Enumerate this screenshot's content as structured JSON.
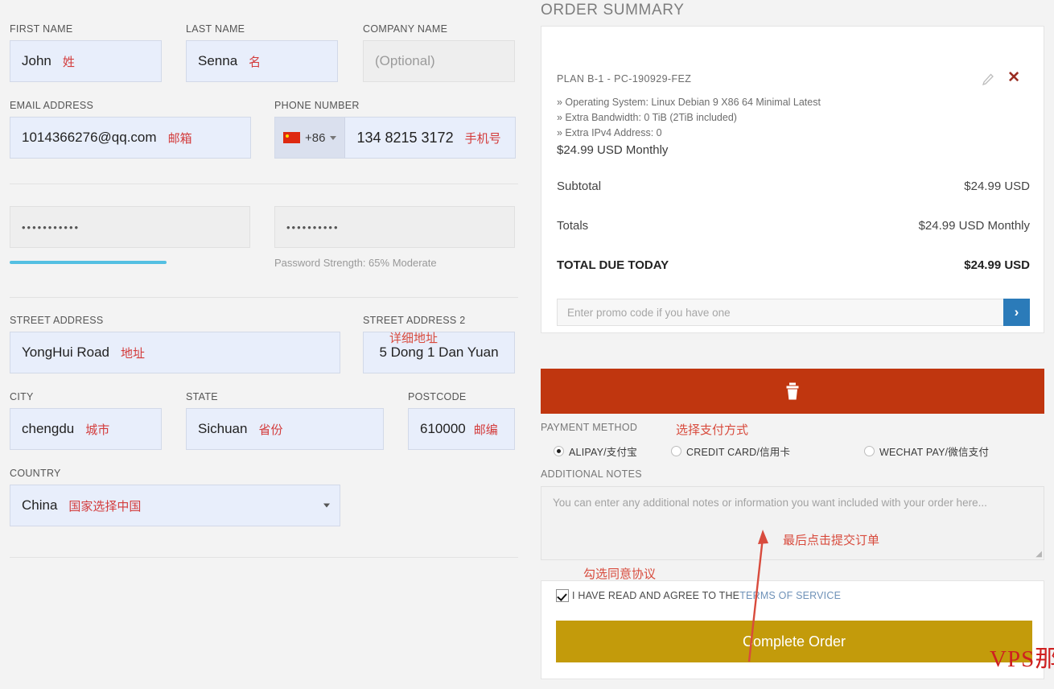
{
  "form": {
    "first_name": {
      "label": "FIRST NAME",
      "value": "John",
      "annotation": "姓"
    },
    "last_name": {
      "label": "LAST NAME",
      "value": "Senna",
      "annotation": "名"
    },
    "company_name": {
      "label": "COMPANY NAME",
      "placeholder": "(Optional)",
      "value": ""
    },
    "email": {
      "label": "EMAIL ADDRESS",
      "value": "1014366276@qq.com",
      "annotation": "邮箱"
    },
    "phone": {
      "label": "PHONE NUMBER",
      "dial_code": "+86",
      "value": "134 8215 3172",
      "annotation": "手机号",
      "flag": "china-flag-icon"
    },
    "password": {
      "value": "•••••••••••"
    },
    "password_confirm": {
      "value": "••••••••••"
    },
    "password_strength": {
      "text": "Password Strength: 65% Moderate",
      "percent": 65,
      "bar_color": "#53bfe2"
    },
    "street_address": {
      "label": "STREET ADDRESS",
      "value": "YongHui Road",
      "annotation": "地址"
    },
    "street_address_2": {
      "label": "STREET ADDRESS 2",
      "value": "5 Dong 1 Dan Yuan",
      "annotation": "详细地址"
    },
    "city": {
      "label": "CITY",
      "value": "chengdu",
      "annotation": "城市"
    },
    "state": {
      "label": "STATE",
      "value": "Sichuan",
      "annotation": "省份"
    },
    "postcode": {
      "label": "POSTCODE",
      "value": "610000",
      "annotation": "邮编"
    },
    "country": {
      "label": "COUNTRY",
      "value": "China",
      "annotation": "国家选择中国"
    }
  },
  "order_summary": {
    "title": "ORDER SUMMARY",
    "plan": {
      "name": "PLAN B-1 - PC-190929-FEZ",
      "features": [
        "» Operating System: Linux Debian 9 X86 64 Minimal Latest",
        "» Extra Bandwidth: 0 TiB (2TiB included)",
        "» Extra IPv4 Address: 0"
      ],
      "price": "$24.99 USD Monthly"
    },
    "lines": [
      {
        "label": "Subtotal",
        "value": "$24.99 USD",
        "bold": false
      },
      {
        "label": "Totals",
        "value": "$24.99 USD Monthly",
        "bold": false
      },
      {
        "label": "TOTAL DUE TODAY",
        "value": "$24.99 USD",
        "bold": true
      }
    ],
    "promo": {
      "placeholder": "Enter promo code if you have one",
      "submit_icon": "chevron-right-icon"
    },
    "delete_banner": {
      "icon": "trash-icon",
      "color": "#c0360f"
    }
  },
  "payment": {
    "label": "PAYMENT METHOD",
    "annotation": "选择支付方式",
    "options": [
      {
        "label": "ALIPAY/支付宝",
        "selected": true
      },
      {
        "label": "CREDIT CARD/信用卡",
        "selected": false
      },
      {
        "label": "WECHAT PAY/微信支付",
        "selected": false
      }
    ]
  },
  "notes": {
    "label": "ADDITIONAL NOTES",
    "placeholder": "You can enter any additional notes or information you want included with your order here..."
  },
  "terms": {
    "annotation": "勾选同意协议",
    "checked": true,
    "text_before": "I HAVE READ AND AGREE TO THE ",
    "link_text": "TERMS OF SERVICE"
  },
  "submit": {
    "label": "Complete Order",
    "annotation": "最后点击提交订单",
    "color": "#c39b0b"
  },
  "watermark": "VPS那些事"
}
